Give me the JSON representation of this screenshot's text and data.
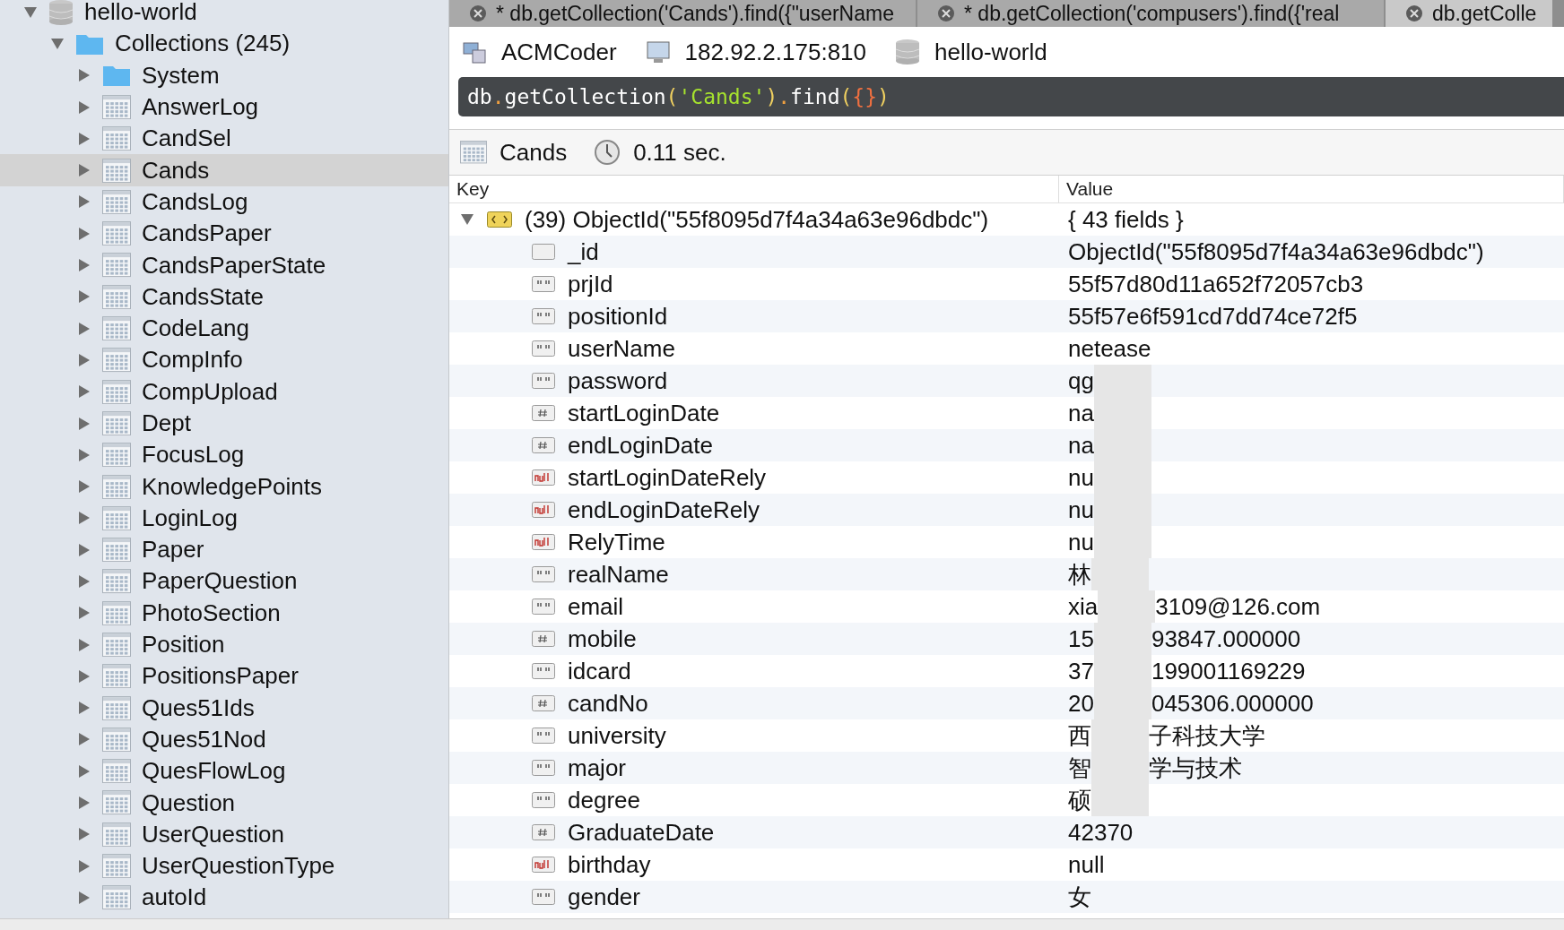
{
  "sidebar": {
    "database": {
      "label": "hello-world",
      "expanded": true
    },
    "folder": {
      "label": "Collections (245)",
      "expanded": true
    },
    "items": [
      {
        "label": "System",
        "kind": "folder",
        "selected": false
      },
      {
        "label": "AnswerLog",
        "kind": "collection",
        "selected": false
      },
      {
        "label": "CandSel",
        "kind": "collection",
        "selected": false
      },
      {
        "label": "Cands",
        "kind": "collection",
        "selected": true
      },
      {
        "label": "CandsLog",
        "kind": "collection",
        "selected": false
      },
      {
        "label": "CandsPaper",
        "kind": "collection",
        "selected": false
      },
      {
        "label": "CandsPaperState",
        "kind": "collection",
        "selected": false
      },
      {
        "label": "CandsState",
        "kind": "collection",
        "selected": false
      },
      {
        "label": "CodeLang",
        "kind": "collection",
        "selected": false
      },
      {
        "label": "CompInfo",
        "kind": "collection",
        "selected": false
      },
      {
        "label": "CompUpload",
        "kind": "collection",
        "selected": false
      },
      {
        "label": "Dept",
        "kind": "collection",
        "selected": false
      },
      {
        "label": "FocusLog",
        "kind": "collection",
        "selected": false
      },
      {
        "label": "KnowledgePoints",
        "kind": "collection",
        "selected": false
      },
      {
        "label": "LoginLog",
        "kind": "collection",
        "selected": false
      },
      {
        "label": "Paper",
        "kind": "collection",
        "selected": false
      },
      {
        "label": "PaperQuestion",
        "kind": "collection",
        "selected": false
      },
      {
        "label": "PhotoSection",
        "kind": "collection",
        "selected": false
      },
      {
        "label": "Position",
        "kind": "collection",
        "selected": false
      },
      {
        "label": "PositionsPaper",
        "kind": "collection",
        "selected": false
      },
      {
        "label": "Ques51Ids",
        "kind": "collection",
        "selected": false
      },
      {
        "label": "Ques51Nod",
        "kind": "collection",
        "selected": false
      },
      {
        "label": "QuesFlowLog",
        "kind": "collection",
        "selected": false
      },
      {
        "label": "Question",
        "kind": "collection",
        "selected": false
      },
      {
        "label": "UserQuestion",
        "kind": "collection",
        "selected": false
      },
      {
        "label": "UserQuestionType",
        "kind": "collection",
        "selected": false
      },
      {
        "label": "autoId",
        "kind": "collection",
        "selected": false
      }
    ]
  },
  "tabs": [
    {
      "label": "* db.getCollection('Cands').find({\"userName",
      "selected": false
    },
    {
      "label": "* db.getCollection('compusers').find({'real",
      "selected": false
    },
    {
      "label": "db.getColle",
      "selected": true
    }
  ],
  "connection": {
    "server": "ACMCoder",
    "address": "182.92.2.175:810",
    "database": "hello-world"
  },
  "query": {
    "object": "db",
    "dot": ".",
    "method": "getCollection",
    "dot2": ".",
    "open": "(",
    "argument": "'Cands'",
    "close": ")",
    "method2": "find",
    "open2": "(",
    "braces": "{}",
    "close2": ")"
  },
  "result": {
    "collection": "Cands",
    "time": "0.11 sec."
  },
  "table": {
    "columns": [
      "Key",
      "Value"
    ],
    "document": {
      "key": "(39) ObjectId(\"55f8095d7f4a34a63e96dbdc\")",
      "value": "{ 43 fields }",
      "expanded": true
    },
    "rows": [
      {
        "kind": "objectid",
        "key": "_id",
        "value": "ObjectId(\"55f8095d7f4a34a63e96dbdc\")",
        "redacted": false
      },
      {
        "kind": "string",
        "key": "prjId",
        "value": "55f57d80d11a652f72057cb3",
        "redacted": false
      },
      {
        "kind": "string",
        "key": "positionId",
        "value": "55f57e6f591cd7dd74ce72f5",
        "redacted": false
      },
      {
        "kind": "string",
        "key": "userName",
        "value": "netease",
        "redacted": false
      },
      {
        "kind": "string",
        "key": "password",
        "value": "qg",
        "redacted": true
      },
      {
        "kind": "number",
        "key": "startLoginDate",
        "value": "na",
        "redacted": true
      },
      {
        "kind": "number",
        "key": "endLoginDate",
        "value": "na",
        "redacted": true
      },
      {
        "kind": "null",
        "key": "startLoginDateRely",
        "value": "nu",
        "redacted": true
      },
      {
        "kind": "null",
        "key": "endLoginDateRely",
        "value": "nu",
        "redacted": true
      },
      {
        "kind": "null",
        "key": "RelyTime",
        "value": "nu",
        "redacted": true
      },
      {
        "kind": "string",
        "key": "realName",
        "value": "林",
        "redacted": true
      },
      {
        "kind": "string",
        "key": "email",
        "value": "xia",
        "tail": "3109@126.com",
        "redacted": true
      },
      {
        "kind": "number",
        "key": "mobile",
        "value": "15",
        "tail": "93847.000000",
        "redacted": true
      },
      {
        "kind": "string",
        "key": "idcard",
        "value": "37",
        "tail": "199001169229",
        "redacted": true
      },
      {
        "kind": "number",
        "key": "candNo",
        "value": "20",
        "tail": "045306.000000",
        "redacted": true
      },
      {
        "kind": "string",
        "key": "university",
        "value": "西",
        "tail": "子科技大学",
        "redacted": true
      },
      {
        "kind": "string",
        "key": "major",
        "value": "智",
        "tail": "学与技术",
        "redacted": true
      },
      {
        "kind": "string",
        "key": "degree",
        "value": "硕",
        "redacted": true
      },
      {
        "kind": "number",
        "key": "GraduateDate",
        "value": "42370",
        "redacted": false
      },
      {
        "kind": "null",
        "key": "birthday",
        "value": "null",
        "redacted": false
      },
      {
        "kind": "string",
        "key": "gender",
        "value": "女",
        "redacted": false
      }
    ]
  }
}
